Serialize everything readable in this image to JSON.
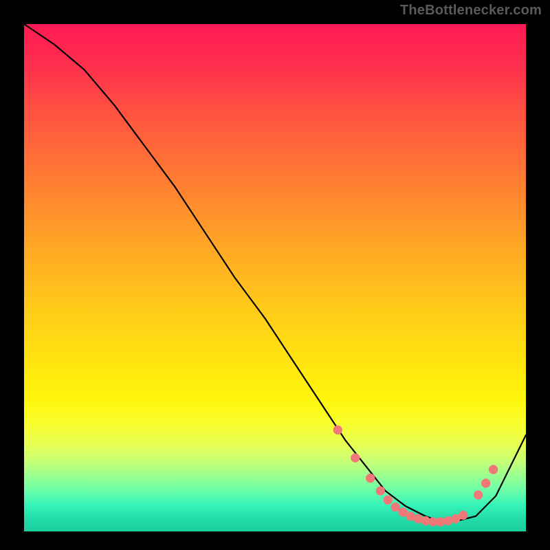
{
  "attribution": "TheBottlenecker.com",
  "colors": {
    "background": "#000000",
    "marker": "#f07878",
    "line": "#000000"
  },
  "chart_data": {
    "type": "line",
    "title": "",
    "xlabel": "",
    "ylabel": "",
    "xlim": [
      0,
      100
    ],
    "ylim": [
      0,
      100
    ],
    "grid": false,
    "legend": false,
    "series": [
      {
        "name": "curve",
        "x": [
          0,
          6,
          12,
          18,
          24,
          30,
          36,
          42,
          48,
          54,
          60,
          64,
          68,
          72,
          76,
          80,
          83,
          86,
          90,
          94,
          97,
          100
        ],
        "values": [
          100,
          96,
          91,
          84,
          76,
          68,
          59,
          50,
          42,
          33,
          24,
          18,
          13,
          8,
          5,
          3,
          2,
          2,
          3,
          7,
          13,
          19
        ]
      }
    ],
    "markers": [
      {
        "x": 62.5,
        "y": 20
      },
      {
        "x": 66.0,
        "y": 14.5
      },
      {
        "x": 69.0,
        "y": 10.5
      },
      {
        "x": 71.0,
        "y": 8.0
      },
      {
        "x": 72.5,
        "y": 6.2
      },
      {
        "x": 74.0,
        "y": 4.8
      },
      {
        "x": 75.5,
        "y": 3.8
      },
      {
        "x": 77.0,
        "y": 3.0
      },
      {
        "x": 78.5,
        "y": 2.5
      },
      {
        "x": 80.0,
        "y": 2.1
      },
      {
        "x": 81.5,
        "y": 1.9
      },
      {
        "x": 83.0,
        "y": 1.9
      },
      {
        "x": 84.5,
        "y": 2.1
      },
      {
        "x": 86.0,
        "y": 2.5
      },
      {
        "x": 87.5,
        "y": 3.2
      },
      {
        "x": 90.5,
        "y": 7.2
      },
      {
        "x": 92.0,
        "y": 9.5
      },
      {
        "x": 93.5,
        "y": 12.2
      }
    ]
  }
}
